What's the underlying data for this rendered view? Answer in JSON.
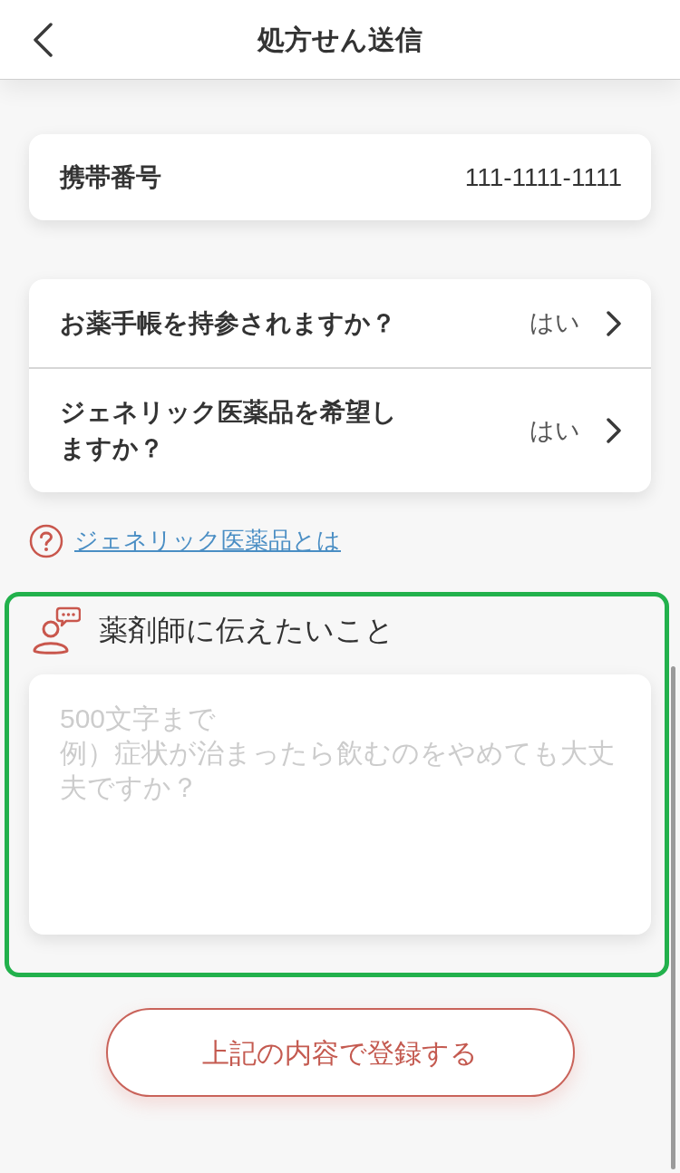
{
  "header": {
    "title": "処方せん送信"
  },
  "phone": {
    "label": "携帯番号",
    "value": "111-1111-1111"
  },
  "questions": [
    {
      "label": "お薬手帳を持参されますか？",
      "answer": "はい"
    },
    {
      "label": "ジェネリック医薬品を希望しますか？",
      "answer": "はい"
    }
  ],
  "help_link": {
    "text": "ジェネリック医薬品とは"
  },
  "message": {
    "title": "薬剤師に伝えたいこと",
    "placeholder": [
      "500文字まで",
      "例）症状が治まったら飲むのをやめても大丈夫ですか？"
    ],
    "highlighted": true
  },
  "submit_button": {
    "label": "上記の内容で登録する"
  }
}
